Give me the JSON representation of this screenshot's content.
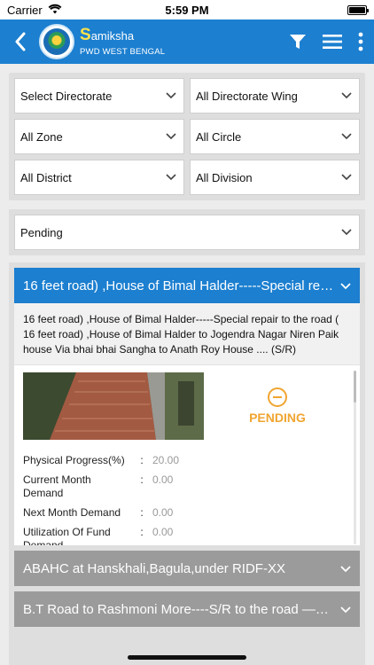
{
  "status": {
    "carrier": "Carrier",
    "time": "5:59 PM"
  },
  "header": {
    "brand_letter": "S",
    "brand_rest": "amiksha",
    "subtitle": "PWD WEST BENGAL"
  },
  "filters": {
    "directorate": "Select Directorate",
    "wing": "All Directorate Wing",
    "zone": "All Zone",
    "circle": "All Circle",
    "district": "All District",
    "division": "All Division"
  },
  "status_filter": "Pending",
  "projects": [
    {
      "title": "16 feet road) ,House of Bimal Halder-----Special repair to the road ( 16 feet road) ,House of Bimal Halder to Jogendra Nagar Niren Paik house Via bhai bhai Sangha to Anath Roy House .... (S/R)",
      "title_short": "16 feet road) ,House of Bimal Halder-----Special re…",
      "description": "16 feet road) ,House of Bimal Halder-----Special repair to the road ( 16 feet road) ,House of Bimal Halder to Jogendra Nagar Niren Paik house Via bhai bhai Sangha to Anath Roy House .... (S/R)",
      "status_label": "PENDING",
      "stats": [
        {
          "label": "Physical Progress(%)",
          "value": "20.00"
        },
        {
          "label": "Current Month Demand",
          "value": "0.00"
        },
        {
          "label": "Next Month Demand",
          "value": "0.00"
        },
        {
          "label": "Utilization Of Fund Demand",
          "value": "0.00"
        }
      ]
    },
    {
      "title": "ABAHC at Hanskhali,Bagula,under RIDF-XX"
    },
    {
      "title": "B.T Road to Rashmoni More----S/R to the road —…"
    }
  ],
  "colors": {
    "header_bg": "#1c7fd0",
    "brand_letter": "#ffe24a",
    "pending": "#f0a530",
    "collapsed_bg": "#9b9b9b"
  },
  "icons": [
    "back-arrow-icon",
    "filter-icon",
    "menu-icon",
    "more-vertical-icon",
    "chevron-down-icon",
    "minus-circle-icon",
    "wifi-icon",
    "battery-icon"
  ]
}
